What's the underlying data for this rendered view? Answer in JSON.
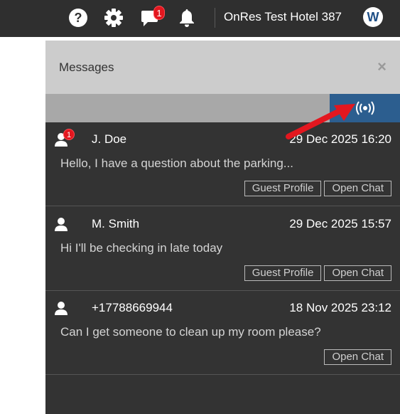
{
  "topbar": {
    "help_icon": "question-circle-icon",
    "settings_icon": "gear-icon",
    "messages_icon": "chat-icon",
    "messages_badge": "1",
    "notifications_icon": "bell-icon",
    "hotel_name": "OnRes Test Hotel 387",
    "avatar_initial": "W"
  },
  "panel": {
    "title": "Messages",
    "close_label": "×",
    "live_icon": "broadcast-icon"
  },
  "messages": [
    {
      "name": "J. Doe",
      "badge": "1",
      "time": "29 Dec 2025 16:20",
      "text": "Hello, I have a question about the parking...",
      "guest_profile_label": "Guest Profile",
      "open_chat_label": "Open Chat"
    },
    {
      "name": "M. Smith",
      "time": "29 Dec 2025 15:57",
      "text": "Hi I'll be checking in late today",
      "guest_profile_label": "Guest Profile",
      "open_chat_label": "Open Chat"
    },
    {
      "name": "+17788669944",
      "time": "18 Nov 2025 23:12",
      "text": "Can I get someone to clean up my room please?",
      "open_chat_label": "Open Chat"
    }
  ],
  "colors": {
    "topbar": "#2f2f2f",
    "panel": "#333333",
    "header": "#cccccc",
    "accent": "#2c5e8f",
    "badge": "#e3171f",
    "annotation_arrow": "#e3171f"
  }
}
